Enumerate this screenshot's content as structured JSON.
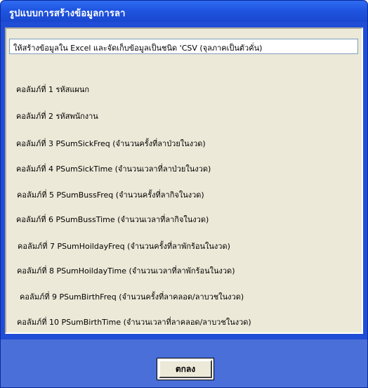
{
  "window": {
    "title": "รูปแบบการสร้างข้อมูลการลา"
  },
  "header": {
    "text": "ให้สร้างข้อมูลใน Excel และจัดเก็บข้อมูลเป็นชนิด 'CSV (จุลภาคเป็นตัวคั่น)"
  },
  "columns": [
    "คอลัมภ์ที่ 1 รหัสแผนก",
    "คอลัมภ์ที่ 2 รหัสพนักงาน",
    "คอลัมภ์ที่ 3 PSumSickFreq (จำนวนครั้งที่ลาป่วยในงวด)",
    "คอลัมภ์ที่ 4 PSumSickTime (จำนวนเวลาที่ลาป่วยในงวด)",
    "คอลัมภ์ที่ 5 PSumBussFreq (จำนวนครั้งที่ลากิจในงวด)",
    "คอลัมภ์ที่ 6 PSumBussTime (จำนวนเวลาที่ลากิจในงวด)",
    "คอลัมภ์ที่ 7 PSumHoildayFreq (จำนวนครั้งที่ลาพักร้อนในงวด)",
    "คอลัมภ์ที่ 8 PSumHoildayTime (จำนวนเวลาที่ลาพักร้อนในงวด)",
    "คอลัมภ์ที่ 9 PSumBirthFreq (จำนวนครั้งที่ลาคลอด/ลาบวชในงวด)",
    "คอลัมภ์ที่ 10 PSumBirthTime (จำนวนเวลาที่ลาคลอด/ลาบวชในงวด)"
  ],
  "buttons": {
    "ok_label": "ตกลง"
  },
  "colors": {
    "title_bar": "#1f55e0",
    "panel": "#ece9d8",
    "footer": "#4a6fd9"
  }
}
